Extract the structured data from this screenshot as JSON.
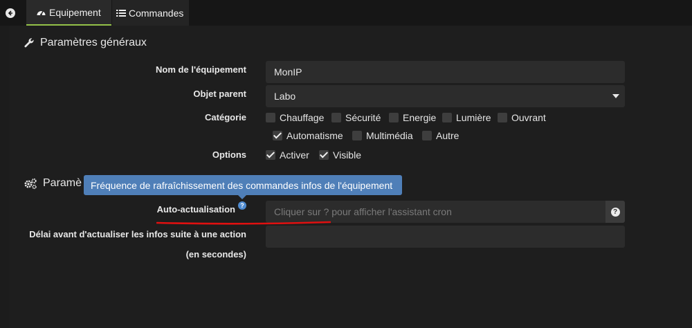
{
  "tabs": {
    "back_icon": "arrow-left-circle-icon",
    "equipement": {
      "label": "Equipement",
      "icon": "tachometer-icon"
    },
    "commandes": {
      "label": "Commandes",
      "icon": "list-icon"
    }
  },
  "general": {
    "title": "Paramètres généraux",
    "icon": "wrench-icon",
    "nom_label": "Nom de l'équipement",
    "nom_value": "MonIP",
    "objet_label": "Objet parent",
    "objet_value": "Labo",
    "categorie_label": "Catégorie",
    "categories": [
      {
        "label": "Chauffage",
        "checked": false
      },
      {
        "label": "Sécurité",
        "checked": false
      },
      {
        "label": "Energie",
        "checked": false
      },
      {
        "label": "Lumière",
        "checked": false
      },
      {
        "label": "Ouvrant",
        "checked": false
      },
      {
        "label": "Automatisme",
        "checked": true
      },
      {
        "label": "Multimédia",
        "checked": false
      },
      {
        "label": "Autre",
        "checked": false
      }
    ],
    "options_label": "Options",
    "options": [
      {
        "label": "Activer",
        "checked": true
      },
      {
        "label": "Visible",
        "checked": true
      }
    ]
  },
  "specific": {
    "title_partial": "Paramè",
    "icon": "cogs-icon",
    "tooltip": "Fréquence de rafraîchissement des commandes infos de l'équipement",
    "auto_label": "Auto-actualisation",
    "auto_help": "?",
    "auto_placeholder": "Cliquer sur ? pour afficher l'assistant cron",
    "cron_button": "?",
    "delai_label_line1": "Délai avant d'actualiser les infos suite à une action",
    "delai_label_line2": "(en secondes)",
    "delai_value": ""
  },
  "colors": {
    "accent": "#94c249",
    "tooltip_bg": "#4f7fb8",
    "annotation_red": "#e01010"
  }
}
